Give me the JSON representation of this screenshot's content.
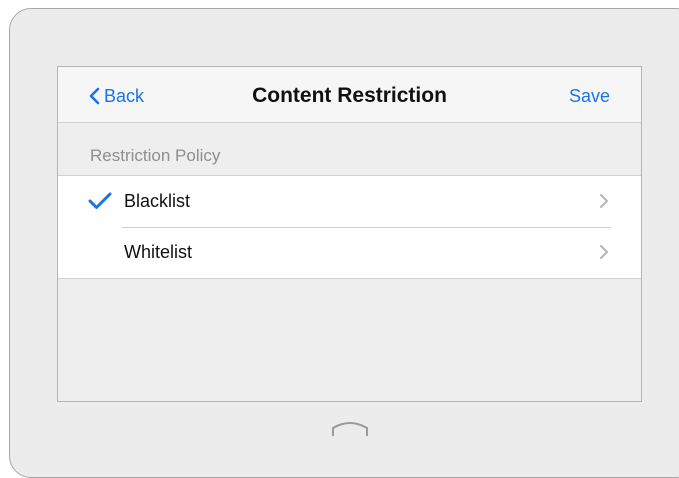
{
  "navbar": {
    "back_label": "Back",
    "title": "Content Restriction",
    "save_label": "Save"
  },
  "section": {
    "header": "Restriction Policy"
  },
  "options": [
    {
      "label": "Blacklist",
      "selected": true
    },
    {
      "label": "Whitelist",
      "selected": false
    }
  ],
  "icons": {
    "back": "chevron-left-icon",
    "check": "checkmark-icon",
    "disclosure": "chevron-right-icon",
    "home": "home-button-icon"
  },
  "colors": {
    "accent": "#1a73e8",
    "device_frame": "#ececec",
    "screen_background": "#eeeeee",
    "list_background": "#ffffff",
    "secondary_text": "#8e8e8e"
  }
}
